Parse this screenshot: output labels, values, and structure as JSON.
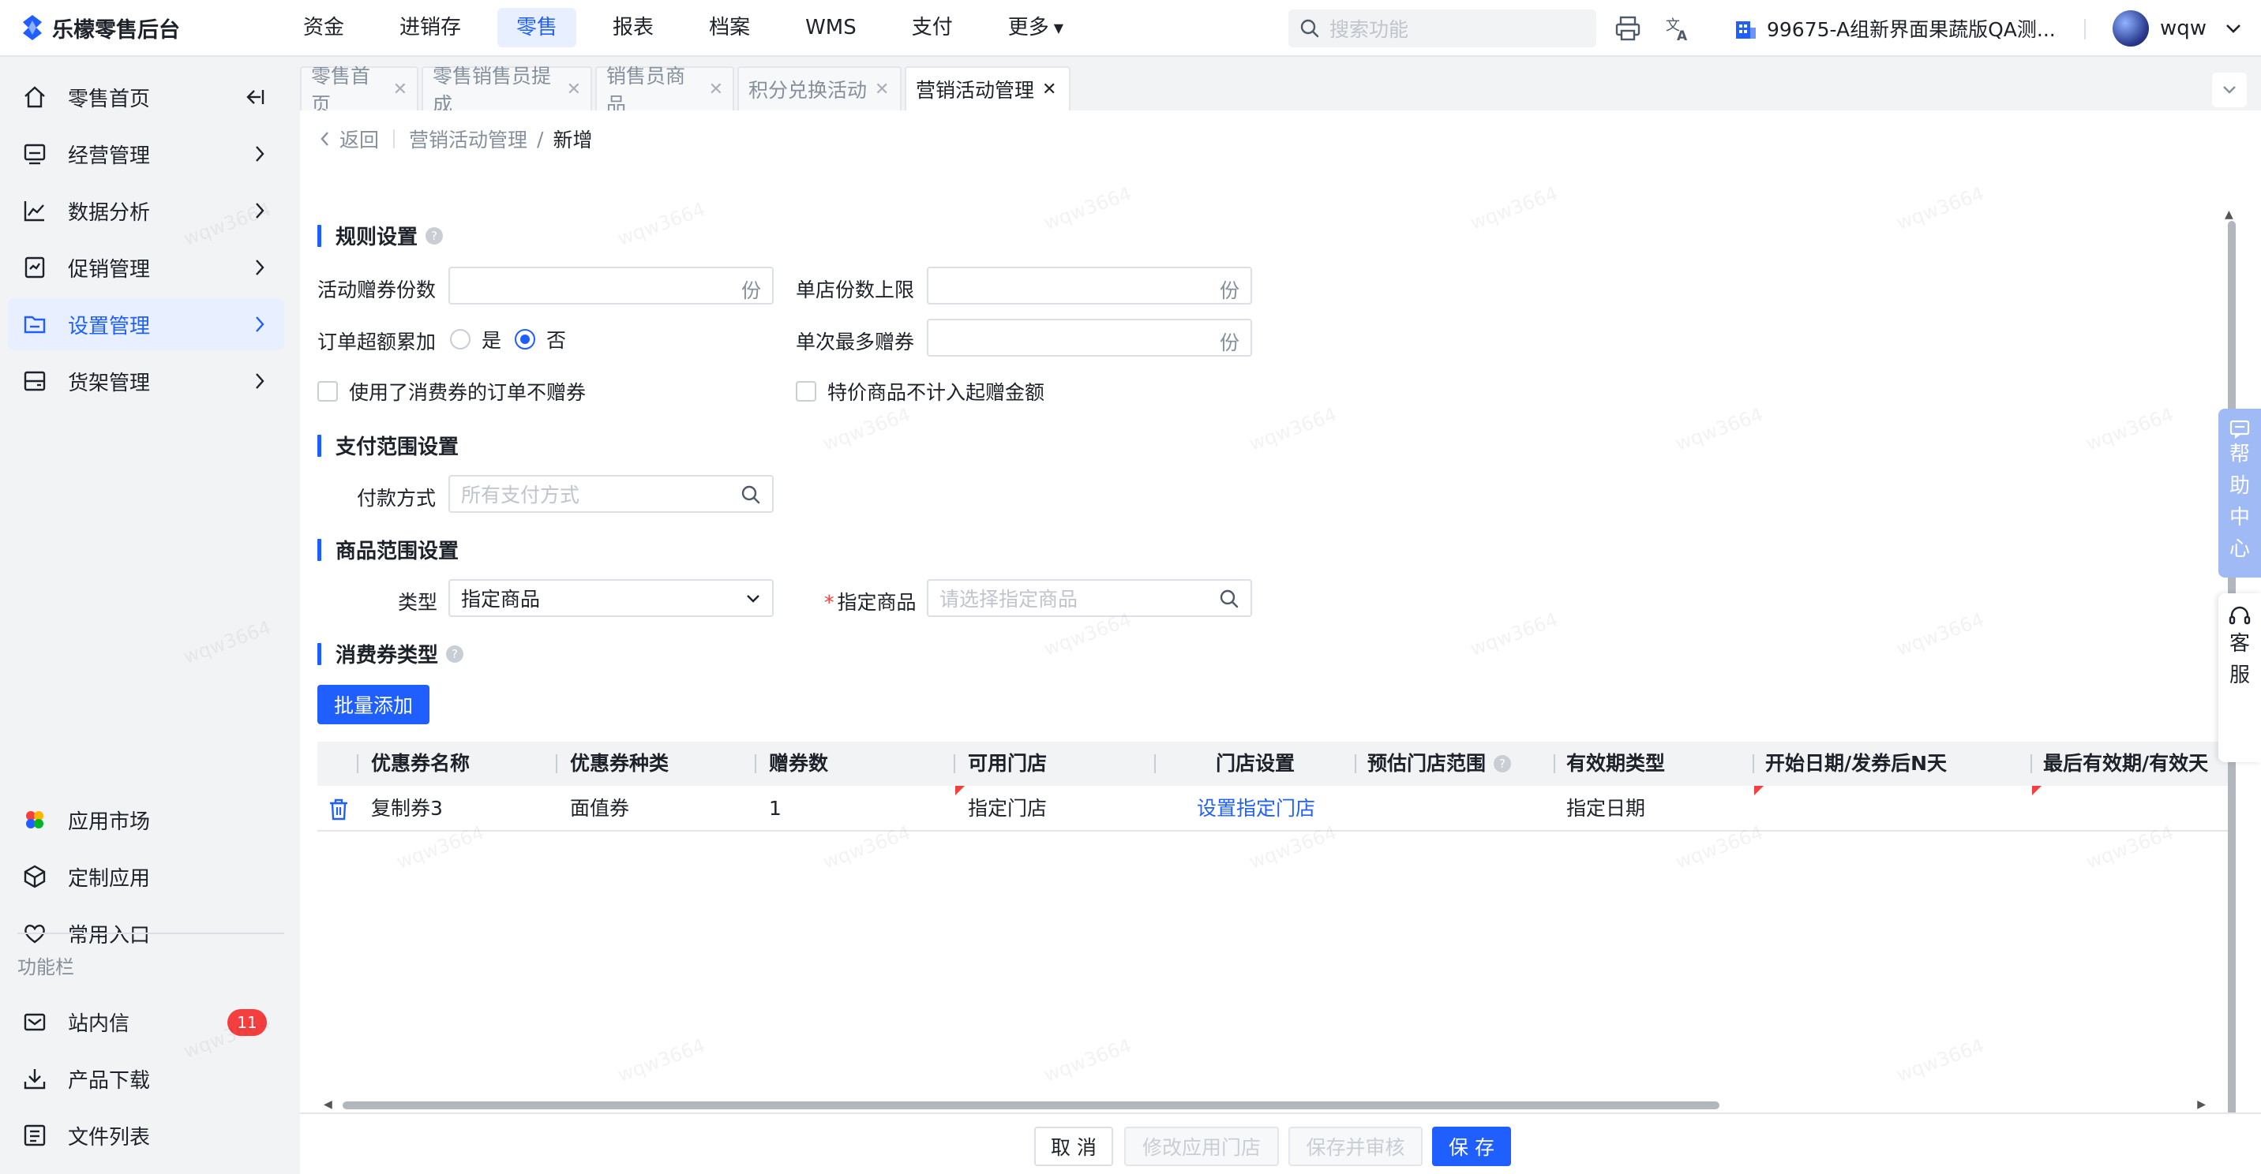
{
  "app": {
    "logo_text": "乐檬零售后台",
    "search_placeholder": "搜索功能",
    "org_name": "99675-A组新界面果蔬版QA测...",
    "user_name": "wqw"
  },
  "top_nav": [
    {
      "label": "资金"
    },
    {
      "label": "进销存"
    },
    {
      "label": "零售",
      "active": true
    },
    {
      "label": "报表"
    },
    {
      "label": "档案"
    },
    {
      "label": "WMS"
    },
    {
      "label": "支付"
    },
    {
      "label": "更多"
    }
  ],
  "sidebar": {
    "items": [
      {
        "label": "零售首页",
        "icon": "home-icon"
      },
      {
        "label": "经营管理",
        "icon": "monitor-icon"
      },
      {
        "label": "数据分析",
        "icon": "chart-line-icon"
      },
      {
        "label": "促销管理",
        "icon": "promo-icon"
      },
      {
        "label": "设置管理",
        "icon": "folder-icon",
        "active": true
      },
      {
        "label": "货架管理",
        "icon": "shelf-icon"
      }
    ],
    "bottom_items": [
      {
        "label": "应用市场",
        "icon": "app-market-icon"
      },
      {
        "label": "定制应用",
        "icon": "cube-icon"
      },
      {
        "label": "常用入口",
        "icon": "heart-icon"
      }
    ],
    "function_bar_label": "功能栏",
    "function_items": [
      {
        "label": "站内信",
        "icon": "mail-icon",
        "badge": "11"
      },
      {
        "label": "产品下载",
        "icon": "download-icon"
      },
      {
        "label": "文件列表",
        "icon": "file-list-icon"
      }
    ]
  },
  "tabs": [
    {
      "label": "零售首页"
    },
    {
      "label": "零售销售员提成"
    },
    {
      "label": "销售员商品"
    },
    {
      "label": "积分兑换活动"
    },
    {
      "label": "营销活动管理",
      "active": true
    }
  ],
  "breadcrumb": {
    "back": "返回",
    "parent": "营销活动管理",
    "separator": "/",
    "current": "新增"
  },
  "rules": {
    "title": "规则设置",
    "coupon_count_label": "活动赠券份数",
    "coupon_count_value": "",
    "unit": "份",
    "store_limit_label": "单店份数上限",
    "store_limit_value": "",
    "order_accumulate_label": "订单超额累加",
    "opt_yes": "是",
    "opt_no": "否",
    "selected": "否",
    "max_per_label": "单次最多赠券",
    "max_per_value": "",
    "chk_used_coupon": "使用了消费券的订单不赠券",
    "chk_special_goods": "特价商品不计入起赠金额"
  },
  "payment": {
    "title": "支付范围设置",
    "method_label": "付款方式",
    "method_placeholder": "所有支付方式"
  },
  "goods": {
    "title": "商品范围设置",
    "type_label": "类型",
    "type_value": "指定商品",
    "goods_label": "指定商品",
    "goods_placeholder": "请选择指定商品"
  },
  "coupon_type": {
    "title": "消费券类型",
    "batch_add": "批量添加",
    "columns": [
      "优惠券名称",
      "优惠券种类",
      "赠券数",
      "可用门店",
      "门店设置",
      "预估门店范围",
      "有效期类型",
      "开始日期/发券后N天",
      "最后有效期/有效天"
    ],
    "rows": [
      {
        "name": "复制券3",
        "kind": "面值券",
        "count": "1",
        "store": "指定门店",
        "store_setting": "设置指定门店",
        "estimate": "",
        "validity_type": "指定日期",
        "start": "",
        "end": ""
      }
    ]
  },
  "footer": {
    "cancel": "取 消",
    "modify_store": "修改应用门店",
    "save_review": "保存并审核",
    "save": "保 存"
  },
  "float": {
    "help": [
      "帮",
      "助",
      "中",
      "心"
    ],
    "service": [
      "客",
      "服"
    ]
  },
  "watermark_text": "wqw3664",
  "colors": {
    "primary": "#1f5eff",
    "danger": "#f53f3f"
  }
}
